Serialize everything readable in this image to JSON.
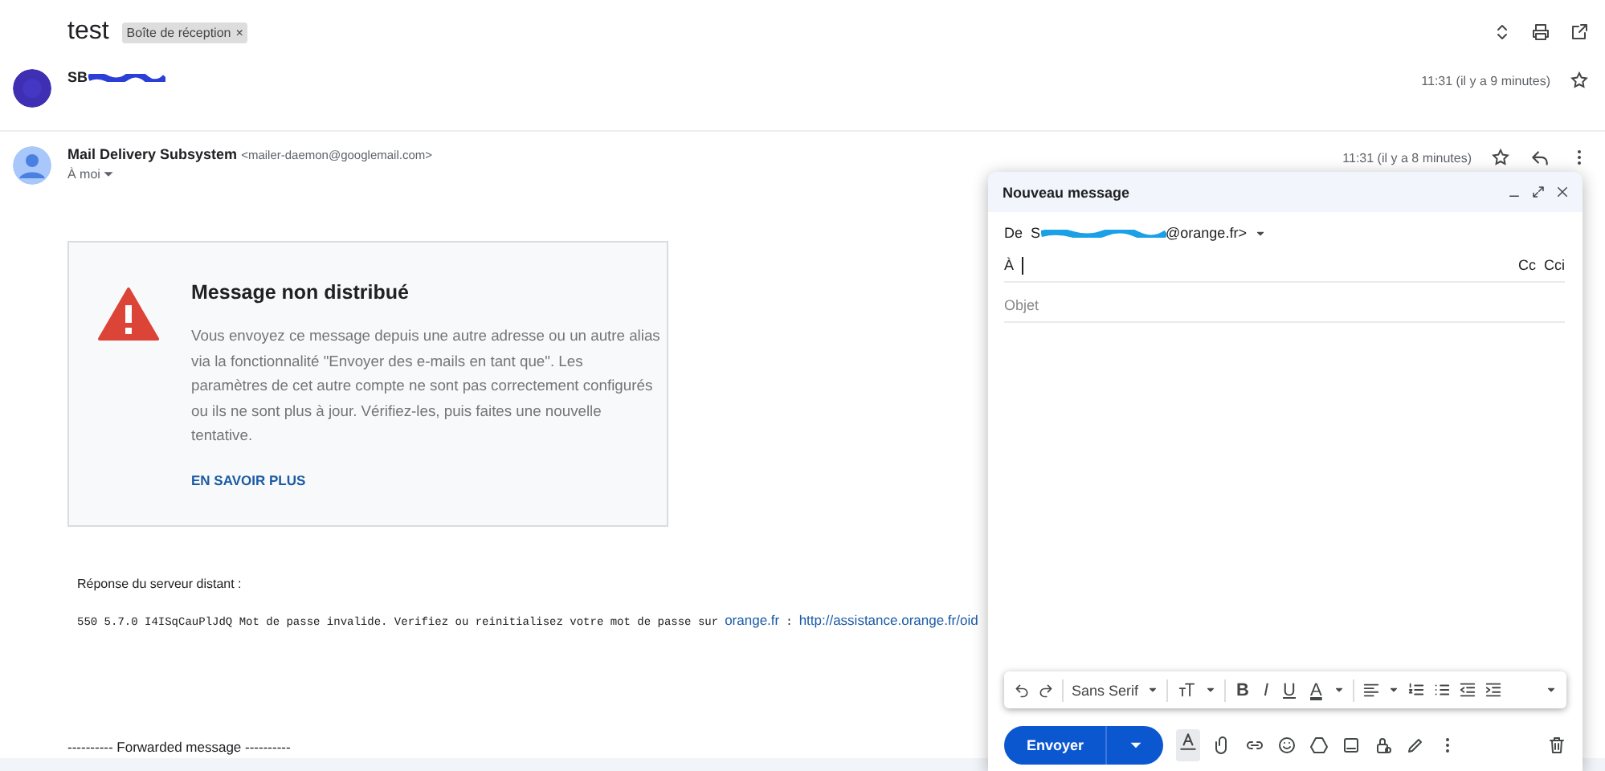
{
  "thread": {
    "subject": "test",
    "label": "Boîte de réception",
    "label_close": "×"
  },
  "messages": [
    {
      "sender": "SB",
      "time": "11:31 (il y a 9 minutes)",
      "starred": false
    },
    {
      "sender": "Mail Delivery Subsystem",
      "address": "<mailer-daemon@googlemail.com>",
      "recipient": "À moi",
      "time": "11:31 (il y a 8 minutes)",
      "starred": false
    }
  ],
  "bounce": {
    "title": "Message non distribué",
    "body": "Vous envoyez ce message depuis une autre adresse ou un autre alias via la fonctionnalité \"Envoyer des e-mails en tant que\". Les paramètres de cet autre compte ne sont pas correctement configurés ou ils ne sont plus à jour. Vérifiez-les, puis faites une nouvelle tentative.",
    "link": "EN SAVOIR PLUS"
  },
  "server_reply": {
    "label": "Réponse du serveur distant :",
    "code": "550 5.7.0 I4ISqCauPlJdQ Mot de passe invalide. Verifiez ou reinitialisez votre mot de passe sur",
    "link": "orange.fr",
    "separator": ":",
    "url": "http://assistance.orange.fr/oid"
  },
  "forwarded": "---------- Forwarded message ----------",
  "compose": {
    "title": "Nouveau message",
    "from_label": "De",
    "from_prefix": "S",
    "from_suffix": "@orange.fr>",
    "to_label": "À",
    "cc": "Cc",
    "bcc": "Cci",
    "subject_placeholder": "Objet",
    "font": "Sans Serif",
    "format": [
      {
        "kind": "bold",
        "label": "B"
      },
      {
        "kind": "italic",
        "label": "I"
      },
      {
        "kind": "underline",
        "label": "U"
      },
      {
        "kind": "color",
        "label": "A"
      }
    ],
    "send": "Envoyer"
  }
}
